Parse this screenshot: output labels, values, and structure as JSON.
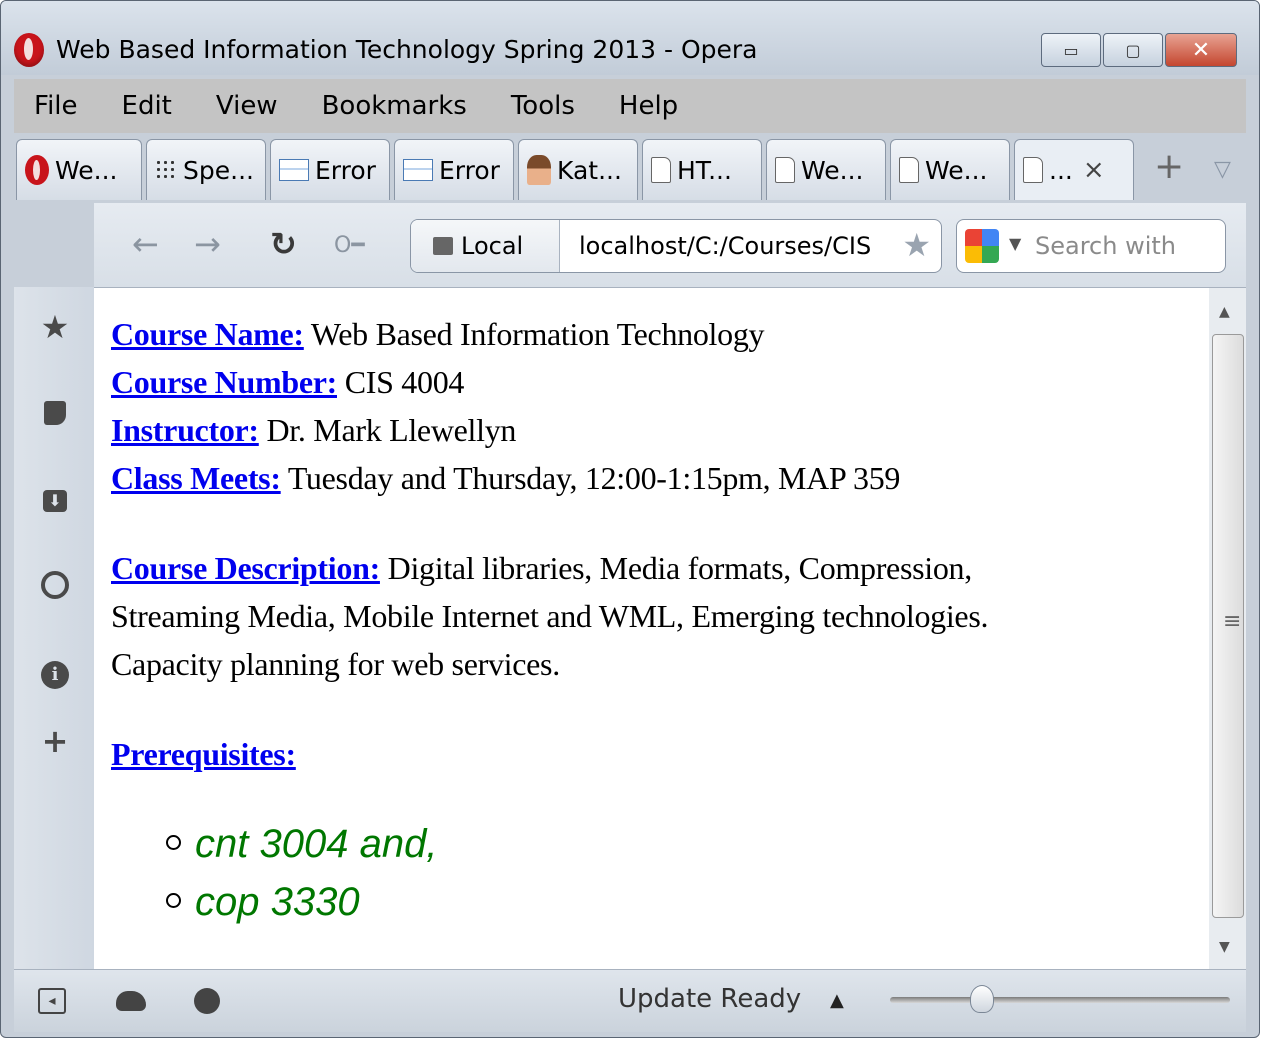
{
  "window": {
    "title": "Web Based Information Technology Spring 2013 - Opera",
    "controls": {
      "minimize": "▭",
      "maximize": "▢",
      "close": "✕"
    }
  },
  "menu": [
    "File",
    "Edit",
    "View",
    "Bookmarks",
    "Tools",
    "Help"
  ],
  "tabs": [
    {
      "label": "We...",
      "icon": "opera-icon"
    },
    {
      "label": "Spe...",
      "icon": "grid-icon"
    },
    {
      "label": "Error",
      "icon": "error-page-icon"
    },
    {
      "label": "Error",
      "icon": "error-page-icon"
    },
    {
      "label": "Kat...",
      "icon": "profile-photo-icon"
    },
    {
      "label": "HT...",
      "icon": "document-icon"
    },
    {
      "label": "We...",
      "icon": "document-icon"
    },
    {
      "label": "We...",
      "icon": "document-icon"
    },
    {
      "label": "...",
      "icon": "document-icon",
      "close": "×",
      "active": true
    }
  ],
  "nav": {
    "back": "←",
    "forward": "→",
    "reload": "↻",
    "key": "🔑",
    "address_badge": "Local",
    "address": "localhost/C:/Courses/CIS",
    "bookmark_star": "★",
    "search_placeholder": "Search with"
  },
  "sidebar": [
    "bookmarks-icon",
    "notes-icon",
    "downloads-icon",
    "history-icon",
    "info-icon",
    "add-panel-icon"
  ],
  "content": {
    "course_name_label": "Course Name:",
    "course_name": "Web Based Information Technology",
    "course_number_label": "Course Number:",
    "course_number": "CIS 4004",
    "instructor_label": "Instructor:",
    "instructor": "Dr. Mark Llewellyn",
    "class_meets_label": "Class Meets:",
    "class_meets": "Tuesday and Thursday, 12:00-1:15pm, MAP 359",
    "description_label": "Course Description:",
    "description_line1": "Digital libraries, Media formats, Compression,",
    "description_line2": "Streaming Media, Mobile Internet and WML, Emerging technologies.",
    "description_line3": "Capacity planning for web services.",
    "prerequisites_label": "Prerequisites:",
    "prerequisites": [
      "cnt 3004 and,",
      "cop 3330"
    ]
  },
  "status": {
    "text": "Update Ready"
  },
  "colors": {
    "link": "#0000ee",
    "prereq_green": "#007700",
    "menubar": "#c4c4c4",
    "close_button": "#c4462f"
  }
}
